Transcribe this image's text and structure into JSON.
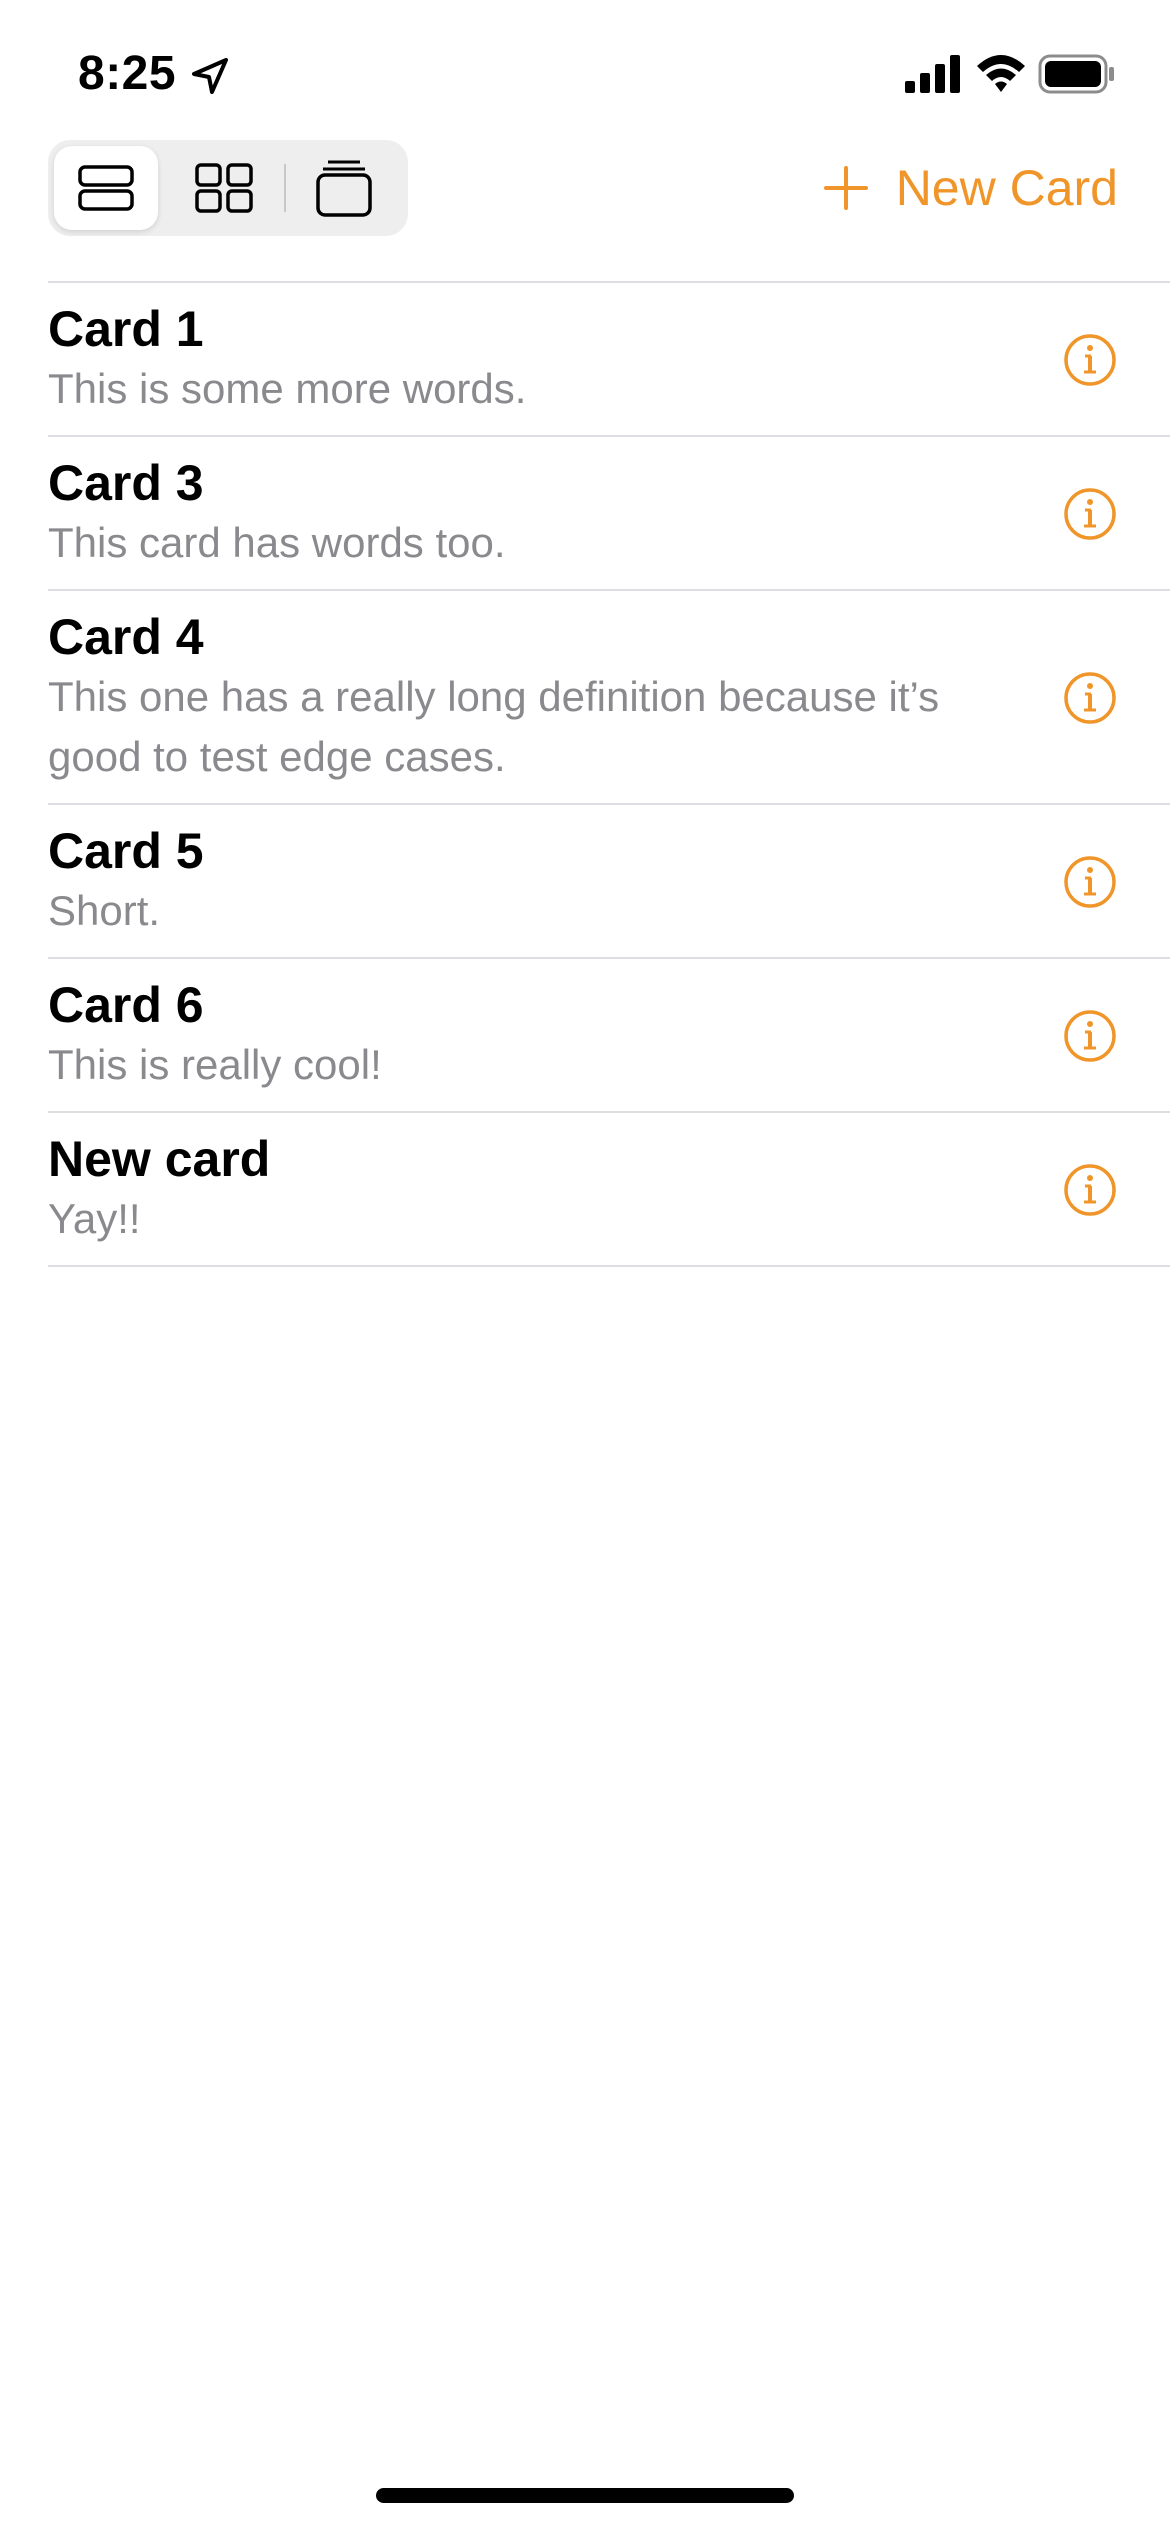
{
  "status_bar": {
    "time": "8:25",
    "location_icon": "location-arrow-icon",
    "signal_icon": "cellular-signal-icon",
    "wifi_icon": "wifi-icon",
    "battery_icon": "battery-full-icon"
  },
  "toolbar": {
    "view_modes": [
      {
        "name": "list-view",
        "icon": "rows-icon",
        "selected": true
      },
      {
        "name": "grid-view",
        "icon": "grid-icon",
        "selected": false
      },
      {
        "name": "stack-view",
        "icon": "card-stack-icon",
        "selected": false
      }
    ],
    "new_card_label": "New Card",
    "new_card_icon": "plus-icon"
  },
  "cards": [
    {
      "title": "Card 1",
      "definition": "This is some more words."
    },
    {
      "title": "Card 3",
      "definition": "This card has words too."
    },
    {
      "title": "Card 4",
      "definition": "This one has a really long definition because it’s good to test edge cases."
    },
    {
      "title": "Card 5",
      "definition": "Short."
    },
    {
      "title": "Card 6",
      "definition": "This is really cool!"
    },
    {
      "title": "New card",
      "definition": "Yay!!"
    }
  ],
  "colors": {
    "accent": "#f0952a",
    "secondary_text": "#8a8a8e",
    "separator": "#dedee2",
    "segmented_bg": "#eeeeef"
  }
}
